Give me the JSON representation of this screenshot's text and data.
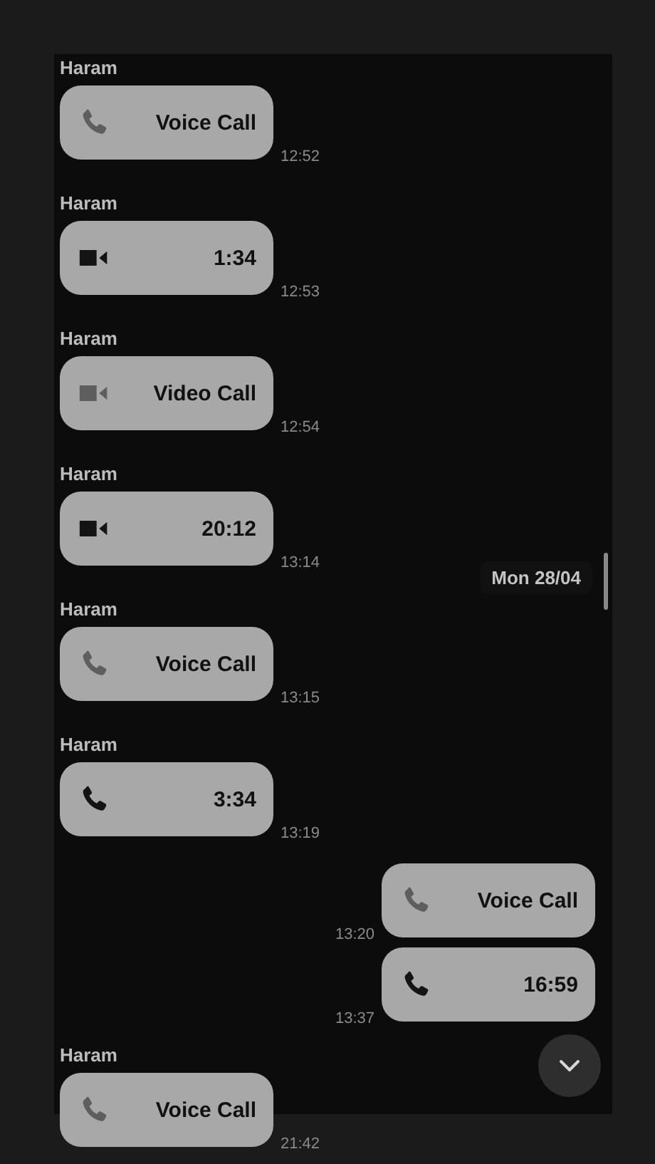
{
  "messages": [
    {
      "sender": "Haram",
      "kind": "voice",
      "answered": false,
      "text": "Voice Call",
      "time": "12:52"
    },
    {
      "sender": "Haram",
      "kind": "video",
      "answered": true,
      "text": "1:34",
      "time": "12:53"
    },
    {
      "sender": "Haram",
      "kind": "video",
      "answered": false,
      "text": "Video Call",
      "time": "12:54"
    },
    {
      "sender": "Haram",
      "kind": "video",
      "answered": true,
      "text": "20:12",
      "time": "13:14"
    },
    {
      "sender": "Haram",
      "kind": "voice",
      "answered": false,
      "text": "Voice Call",
      "time": "13:15"
    },
    {
      "sender": "Haram",
      "kind": "voice",
      "answered": true,
      "text": "3:34",
      "time": "13:19"
    },
    {
      "kind": "voice",
      "answered": false,
      "text": "Voice Call",
      "time": "13:20"
    },
    {
      "kind": "voice",
      "answered": true,
      "text": "16:59",
      "time": "13:37"
    },
    {
      "sender": "Haram",
      "kind": "voice",
      "answered": false,
      "text": "Voice Call",
      "time": "21:42"
    }
  ],
  "date_chip": "Mon 28/04"
}
